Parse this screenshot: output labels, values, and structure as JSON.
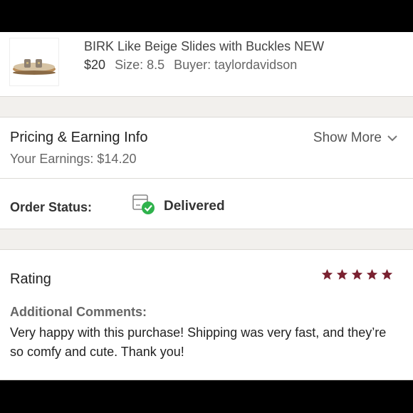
{
  "item": {
    "title": "BIRK Like Beige Slides with Buckles NEW",
    "price": "$20",
    "size": "Size: 8.5",
    "buyer": "Buyer: taylordavidson",
    "thumbnail_icon": "sandal-image"
  },
  "pricing": {
    "title": "Pricing & Earning Info",
    "earnings": "Your Earnings: $14.20",
    "show_more": "Show More"
  },
  "status": {
    "label": "Order Status:",
    "value": "Delivered",
    "icon": "box-check-icon"
  },
  "rating": {
    "title": "Rating",
    "stars": 5,
    "star_color": "#7a2231",
    "comments_label": "Additional Comments:",
    "comments": "Very happy with this purchase! Shipping was very fast, and they’re so comfy and cute. Thank you!"
  },
  "colors": {
    "delivered_green": "#2fb24c",
    "separator": "#f2f0ed"
  }
}
